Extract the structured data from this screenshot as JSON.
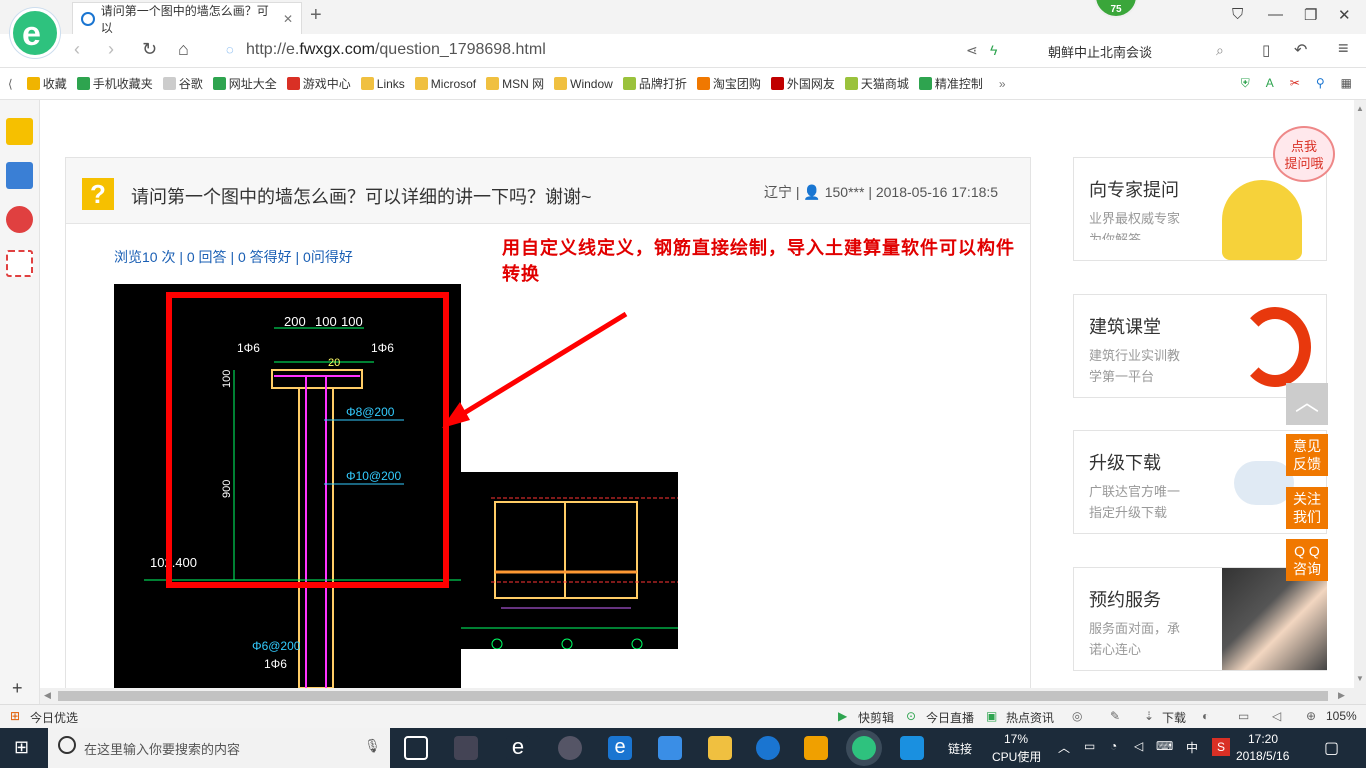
{
  "browser": {
    "tab_title": "请问第一个图中的墙怎么画？可以",
    "url_prefix": "http://e.",
    "url_domain": "fwxgx.com",
    "url_path": "/question_1798698.html",
    "search_text": "朝鲜中止北南会谈",
    "badge_count": "75"
  },
  "bookmarks": [
    {
      "label": "收藏",
      "color": "#f0b400"
    },
    {
      "label": "手机收藏夹",
      "color": "#2ea44f"
    },
    {
      "label": "谷歌",
      "color": "#cccccc"
    },
    {
      "label": "网址大全",
      "color": "#2ea44f"
    },
    {
      "label": "游戏中心",
      "color": "#d93025"
    },
    {
      "label": "Links",
      "color": "#f0c040"
    },
    {
      "label": "Microsof",
      "color": "#f0c040"
    },
    {
      "label": "MSN 网",
      "color": "#f0c040"
    },
    {
      "label": "Window",
      "color": "#f0c040"
    },
    {
      "label": "品牌打折",
      "color": "#9ac23c"
    },
    {
      "label": "淘宝团购",
      "color": "#f07800"
    },
    {
      "label": "外国网友",
      "color": "#c00000"
    },
    {
      "label": "天猫商城",
      "color": "#9ac23c"
    },
    {
      "label": "精准控制",
      "color": "#2ea44f"
    }
  ],
  "question": {
    "title": "请问第一个图中的墙怎么画？可以详细的讲一下吗？谢谢~",
    "meta": "辽宁 | 👤 150*** | 2018-05-16 17:18:5",
    "stats": "浏览10 次 | 0 回答 | 0 答得好 | 0问得好",
    "annotation": "用自定义线定义，钢筋直接绘制，导入土建算量软件可以构件转换"
  },
  "drawing": {
    "dim_top": [
      "200",
      "100",
      "100"
    ],
    "label_phi6_left": "1Φ6",
    "label_phi6_right": "1Φ6",
    "dim_20": "20",
    "dim_100": "100",
    "dim_900": "900",
    "rebar_1": "Φ8@200",
    "rebar_2": "Φ10@200",
    "elevation": "102.400",
    "rebar_3": "Φ6@200",
    "rebar_4": "1Φ6"
  },
  "right_cards": [
    {
      "title": "向专家提问",
      "desc": "业界最权威专家\n为你解答"
    },
    {
      "title": "建筑课堂",
      "desc": "建筑行业实训教\n学第一平台"
    },
    {
      "title": "升级下载",
      "desc": "广联达官方唯一\n指定升级下载"
    },
    {
      "title": "预约服务",
      "desc": "服务面对面，承\n诺心连心"
    }
  ],
  "bubble": "点我\n提问哦",
  "float_buttons": [
    "意见\n反馈",
    "关注\n我们",
    "Q Q\n咨询"
  ],
  "statusbar": {
    "left": "今日优选",
    "items": [
      "快剪辑",
      "今日直播",
      "热点资讯",
      "下载"
    ],
    "zoom": "105%"
  },
  "taskbar": {
    "search_placeholder": "在这里输入你要搜索的内容",
    "link": "链接",
    "cpu": "17%",
    "cpu_label": "CPU使用",
    "ime": "中",
    "time": "17:20",
    "date": "2018/5/16"
  }
}
